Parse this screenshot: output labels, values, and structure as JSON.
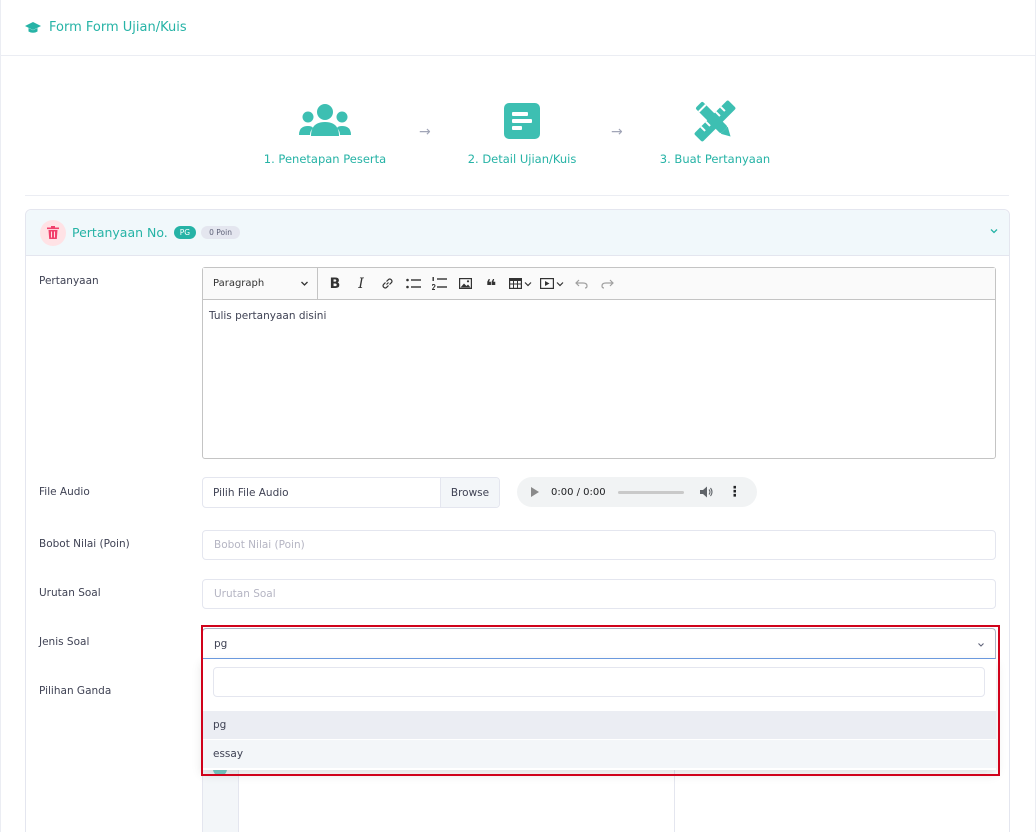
{
  "header": {
    "title": "Form Form Ujian/Kuis",
    "icon": "graduation-cap-icon"
  },
  "stepper": {
    "steps": [
      {
        "label": "1. Penetapan Peserta",
        "icon": "users-icon"
      },
      {
        "label": "2. Detail Ujian/Kuis",
        "icon": "document-icon"
      },
      {
        "label": "3. Buat Pertanyaan",
        "icon": "pencil-ruler-icon"
      }
    ],
    "arrow": "→"
  },
  "question": {
    "title": "Pertanyaan No.",
    "type_badge": "PG",
    "points_badge": "0 Poin"
  },
  "form": {
    "pertanyaan_label": "Pertanyaan",
    "editor": {
      "paragraph": "Paragraph",
      "body": "Tulis pertanyaan disini",
      "tools": [
        "bold-icon",
        "italic-icon",
        "link-icon",
        "bulleted-list-icon",
        "numbered-list-icon",
        "image-icon",
        "quote-icon",
        "table-icon",
        "media-icon",
        "undo-icon",
        "redo-icon"
      ]
    },
    "file_audio_label": "File Audio",
    "file_audio_value": "Pilih File Audio",
    "browse_label": "Browse",
    "audio_time": "0:00 / 0:00",
    "bobot_label": "Bobot Nilai (Poin)",
    "bobot_placeholder": "Bobot Nilai (Poin)",
    "urutan_label": "Urutan Soal",
    "urutan_placeholder": "Urutan Soal",
    "jenis_label": "Jenis Soal",
    "jenis_value": "pg",
    "jenis_options": [
      "pg",
      "essay"
    ],
    "pilihan_label": "Pilihan Ganda"
  },
  "colors": {
    "accent": "#26b3a6",
    "danger": "#f1416c",
    "highlight": "#d0021b"
  }
}
